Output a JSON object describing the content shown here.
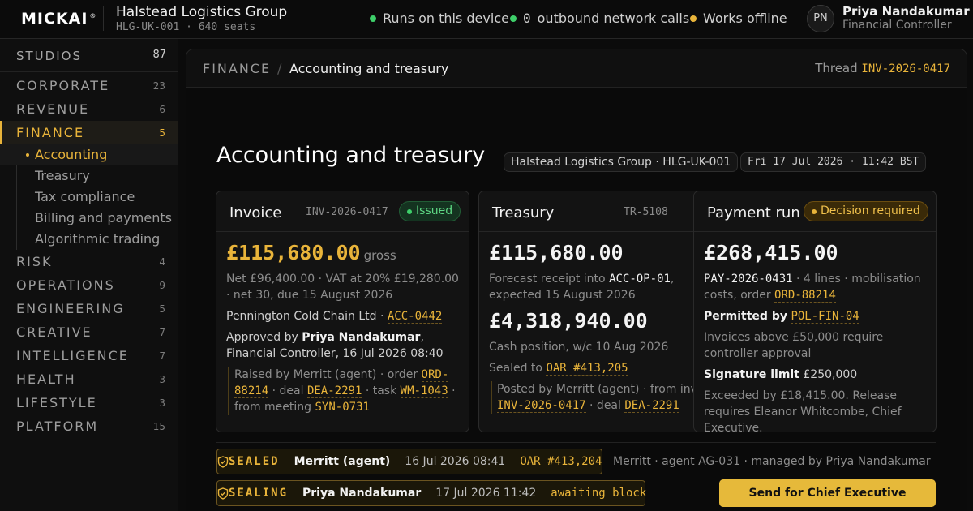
{
  "topbar": {
    "logo": "MICKAI",
    "logo_mark": "®",
    "org_name": "Halstead Logistics Group",
    "org_sub": "HLG-UK-001 · 640 seats",
    "status": [
      {
        "label": "Runs on this device",
        "color": "#3ecf6a"
      },
      {
        "count": "0",
        "label": "outbound network calls",
        "color": "#3ecf6a"
      },
      {
        "label": "Works offline",
        "color": "#e9b43a"
      }
    ],
    "user_initials": "PN",
    "user_name": "Priya Nandakumar",
    "user_role": "Financial Controller"
  },
  "sidebar": {
    "studios_label": "STUDIOS",
    "studios_count": "87",
    "categories": [
      {
        "label": "CORPORATE",
        "count": "23"
      },
      {
        "label": "REVENUE",
        "count": "6"
      },
      {
        "label": "FINANCE",
        "count": "5",
        "active": true
      },
      {
        "label": "RISK",
        "count": "4"
      },
      {
        "label": "OPERATIONS",
        "count": "9"
      },
      {
        "label": "ENGINEERING",
        "count": "5"
      },
      {
        "label": "CREATIVE",
        "count": "7"
      },
      {
        "label": "INTELLIGENCE",
        "count": "7"
      },
      {
        "label": "HEALTH",
        "count": "3"
      },
      {
        "label": "LIFESTYLE",
        "count": "3"
      },
      {
        "label": "PLATFORM",
        "count": "15"
      }
    ],
    "finance_items": [
      "Accounting",
      "Treasury",
      "Tax compliance",
      "Billing and payments",
      "Algorithmic trading"
    ]
  },
  "breadcrumb": {
    "section": "FINANCE",
    "separator": "/",
    "page": "Accounting and treasury",
    "thread_label": "Thread",
    "thread_id": "INV-2026-0417"
  },
  "header": {
    "title": "Accounting and treasury",
    "org_chip": "Halstead Logistics Group · HLG-UK-001",
    "date_chip": "Fri 17 Jul 2026 · 11:42 BST"
  },
  "invoice": {
    "title": "Invoice",
    "id": "INV-2026-0417",
    "status": "Issued",
    "amount": "£115,680.00",
    "amount_suffix": "gross",
    "detail": "Net £96,400.00 · VAT at 20% £19,280.00 · net 30, due 15 August 2026",
    "customer": "Pennington Cold Chain Ltd ·",
    "customer_ref": "ACC-0442",
    "approved_prefix": "Approved by",
    "approved_by": "Priya Nandakumar",
    "approved_suffix": ", Financial Controller, 16 Jul 2026 08:40",
    "raised": "Raised by Merritt (agent) · order",
    "order_ref": "ORD-88214",
    "deal_label": "· deal",
    "deal_ref": "DEA-2291",
    "task_label": "· task",
    "task_ref": "WM-1043",
    "meeting_label": "· from meeting",
    "meeting_ref": "SYN-0731"
  },
  "treasury": {
    "title": "Treasury",
    "id": "TR-5108",
    "amount": "£115,680.00",
    "forecast_prefix": "Forecast receipt into",
    "forecast_account": "ACC-OP-01",
    "forecast_suffix": ", expected 15 August 2026",
    "cash_amount": "£4,318,940.00",
    "cash_label": "Cash position, w/c 10 Aug 2026",
    "sealed_label": "Sealed to",
    "sealed_ref": "OAR #413,205",
    "posted": "Posted by Merritt (agent) · from invoice",
    "posted_ref": "INV-2026-0417",
    "deal_label": "· deal",
    "deal_ref": "DEA-2291"
  },
  "payment_run": {
    "title": "Payment run",
    "status": "Decision required",
    "amount": "£268,415.00",
    "run_ref": "PAY-2026-0431",
    "run_detail": "· 4 lines · mobilisation costs, order",
    "order_ref": "ORD-88214",
    "permitted_label": "Permitted by",
    "policy_ref": "POL-FIN-04",
    "policy_text": "Invoices above £50,000 require controller approval",
    "limit_label": "Signature limit",
    "limit_value": "£250,000",
    "exceeded_text": "Exceeded by £18,415.00. Release requires Eleanor Whitcombe, Chief Executive."
  },
  "seals": [
    {
      "label": "SEALED",
      "who": "Merritt (agent)",
      "when": "16 Jul 2026 08:41",
      "ref": "OAR #413,204"
    },
    {
      "label": "SEALING",
      "who": "Priya Nandakumar",
      "when": "17 Jul 2026 11:42",
      "ref": "awaiting block"
    }
  ],
  "sealed_meta": "Merritt · agent AG-031 · managed by Priya Nandakumar",
  "cta_label": "Send for Chief Executive signature",
  "colors": {
    "accent": "#e9b43a",
    "success": "#3ecf6a",
    "background": "#0b0b0b"
  }
}
